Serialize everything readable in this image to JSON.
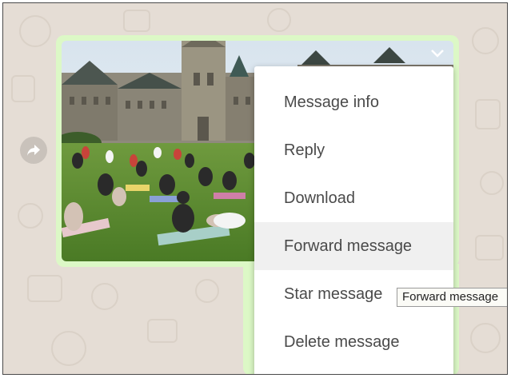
{
  "message": {
    "forward_button_icon": "forward-arrow-icon",
    "menu_icon": "chevron-down-icon",
    "image_description_alt": ""
  },
  "context_menu": {
    "items": [
      {
        "label": "Message info"
      },
      {
        "label": "Reply"
      },
      {
        "label": "Download"
      },
      {
        "label": "Forward message"
      },
      {
        "label": "Star message"
      },
      {
        "label": "Delete message"
      }
    ],
    "hovered_index": 3
  },
  "tooltip": {
    "text": "Forward message"
  },
  "colors": {
    "chat_background": "#e5ddd5",
    "bubble_background": "#dcf8c6",
    "menu_background": "#ffffff",
    "menu_text": "#4a4a4a"
  }
}
